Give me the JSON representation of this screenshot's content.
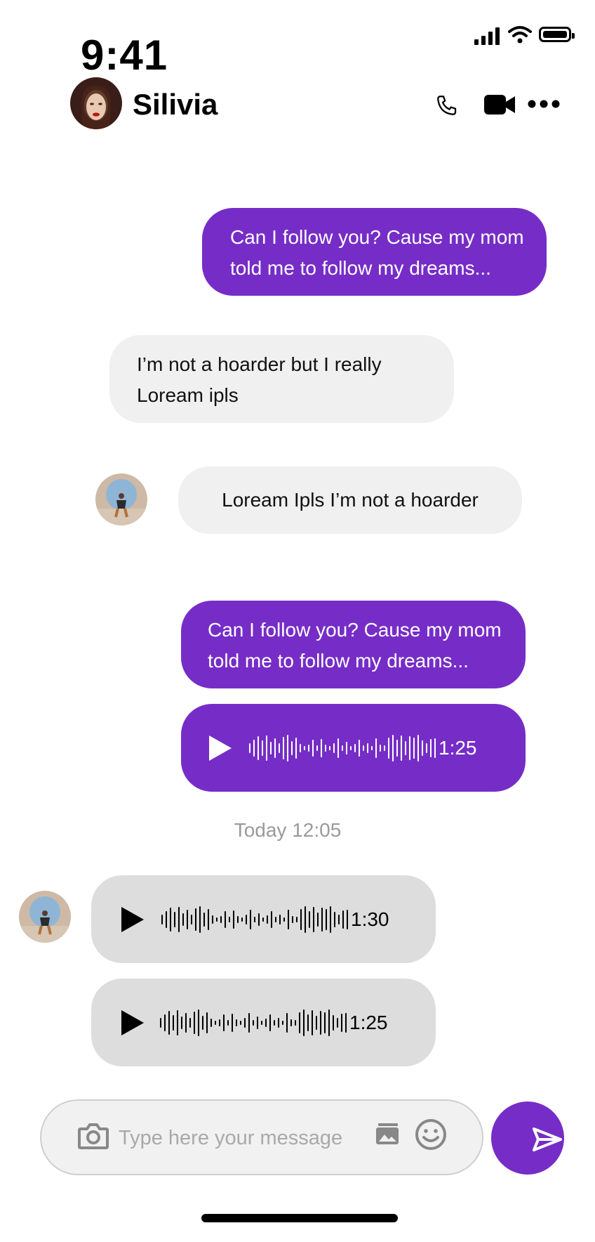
{
  "status_bar": {
    "time": "9:41"
  },
  "header": {
    "contact_name": "Silivia"
  },
  "messages": [
    {
      "text": "Can I follow you? Cause my mom\ntold me to follow my dreams..."
    },
    {
      "text": "I’m not a hoarder but I really\nLoream ipls"
    },
    {
      "text": "Loream Ipls I’m not a hoarder"
    },
    {
      "text": "Can I follow you? Cause my mom\ntold me to follow my dreams..."
    },
    {
      "duration": "1:25"
    },
    {
      "duration": "1:30"
    },
    {
      "duration": "1:25"
    }
  ],
  "timestamp": "Today 12:05",
  "composer": {
    "placeholder": "Type here your message"
  },
  "colors": {
    "accent": "#762DC7",
    "incoming_bubble": "#F0F0F0",
    "incoming_voice": "#DDDDDD",
    "timestamp": "#9A9A9A"
  },
  "icons": [
    "cellular-signal-icon",
    "wifi-icon",
    "battery-icon",
    "phone-icon",
    "video-camera-icon",
    "more-icon",
    "play-icon",
    "camera-icon",
    "gallery-icon",
    "emoji-icon",
    "send-icon"
  ]
}
